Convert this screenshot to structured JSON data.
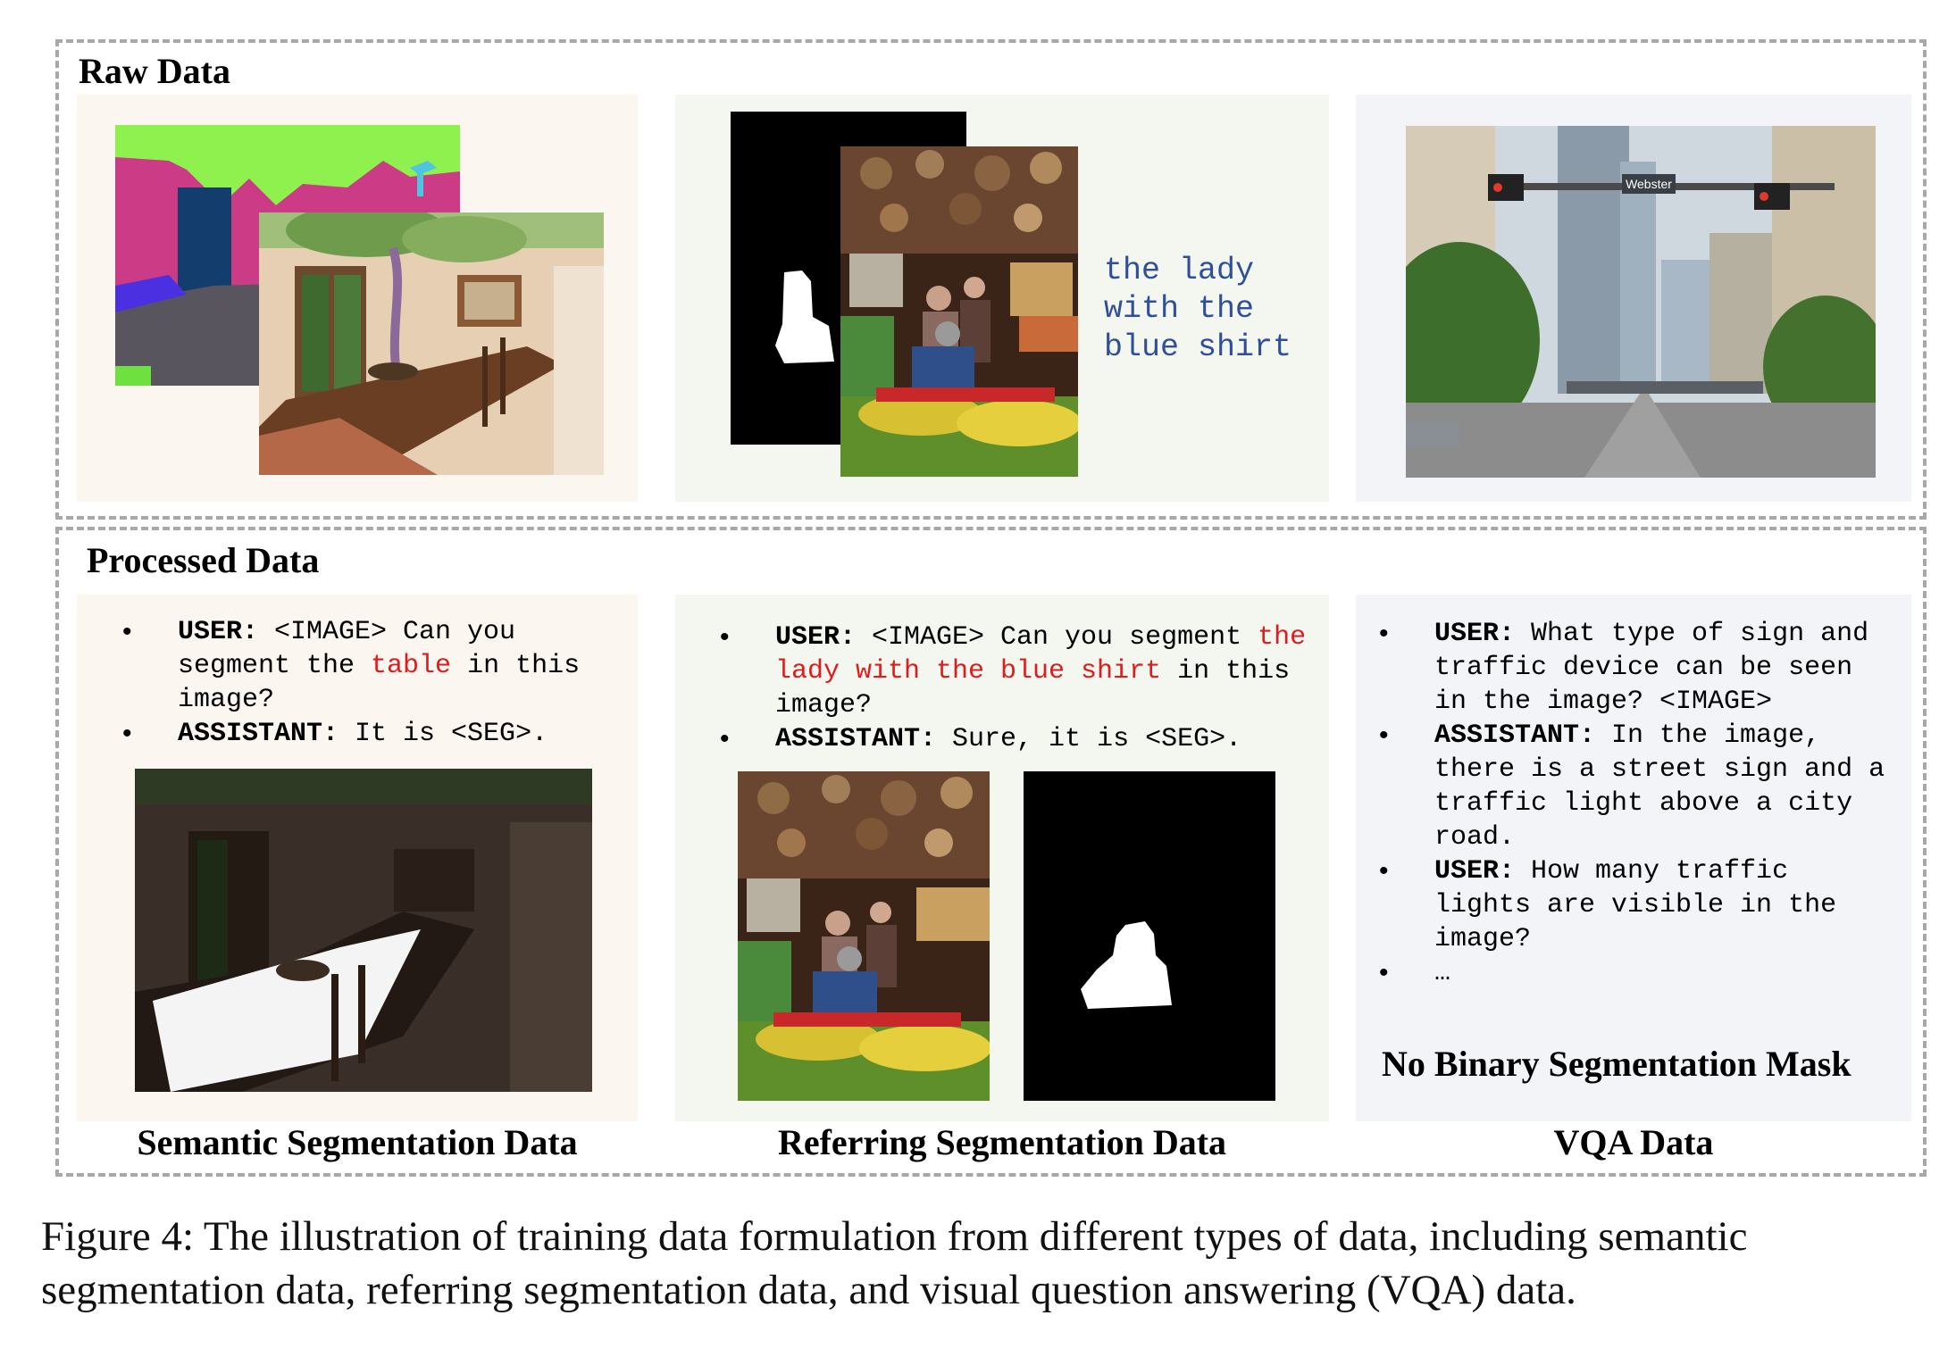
{
  "raw": {
    "title": "Raw Data"
  },
  "processed": {
    "title": "Processed Data"
  },
  "referring_raw": {
    "expression_lines": [
      "the lady",
      "with the",
      "blue shirt"
    ]
  },
  "semantic": {
    "bullets": [
      {
        "role": "USER:",
        "pre": " <IMAGE> Can you segment the ",
        "highlight": "table",
        "post": " in this image?"
      },
      {
        "role": "ASSISTANT:",
        "pre": " It is <SEG>.",
        "highlight": "",
        "post": ""
      }
    ],
    "label": "Semantic Segmentation Data"
  },
  "referring": {
    "bullets": [
      {
        "role": "USER:",
        "pre": " <IMAGE> Can you segment ",
        "highlight": "the lady with the blue shirt",
        "post": " in this image?"
      },
      {
        "role": "ASSISTANT:",
        "pre": " Sure, it is <SEG>.",
        "highlight": "",
        "post": ""
      }
    ],
    "label": "Referring Segmentation Data"
  },
  "vqa": {
    "bullets": [
      {
        "role": "USER:",
        "text": " What type of sign and traffic device can be seen in the image? <IMAGE>"
      },
      {
        "role": "ASSISTANT:",
        "text": " In the image, there is a street sign and a traffic light above a city road."
      },
      {
        "role": "USER:",
        "text": " How many traffic lights are visible in the image?"
      },
      {
        "role": "",
        "text": "…"
      }
    ],
    "no_mask": "No Binary Segmentation Mask",
    "label": "VQA Data"
  },
  "street_sign": "Webster",
  "caption": "Figure 4: The illustration of training data formulation from different types of data, including semantic segmentation data, referring segmentation data, and visual question answering (VQA) data.",
  "colors": {
    "highlight": "#e11b1b",
    "expression": "#2f4f9a",
    "dash": "#a8a8a8"
  }
}
